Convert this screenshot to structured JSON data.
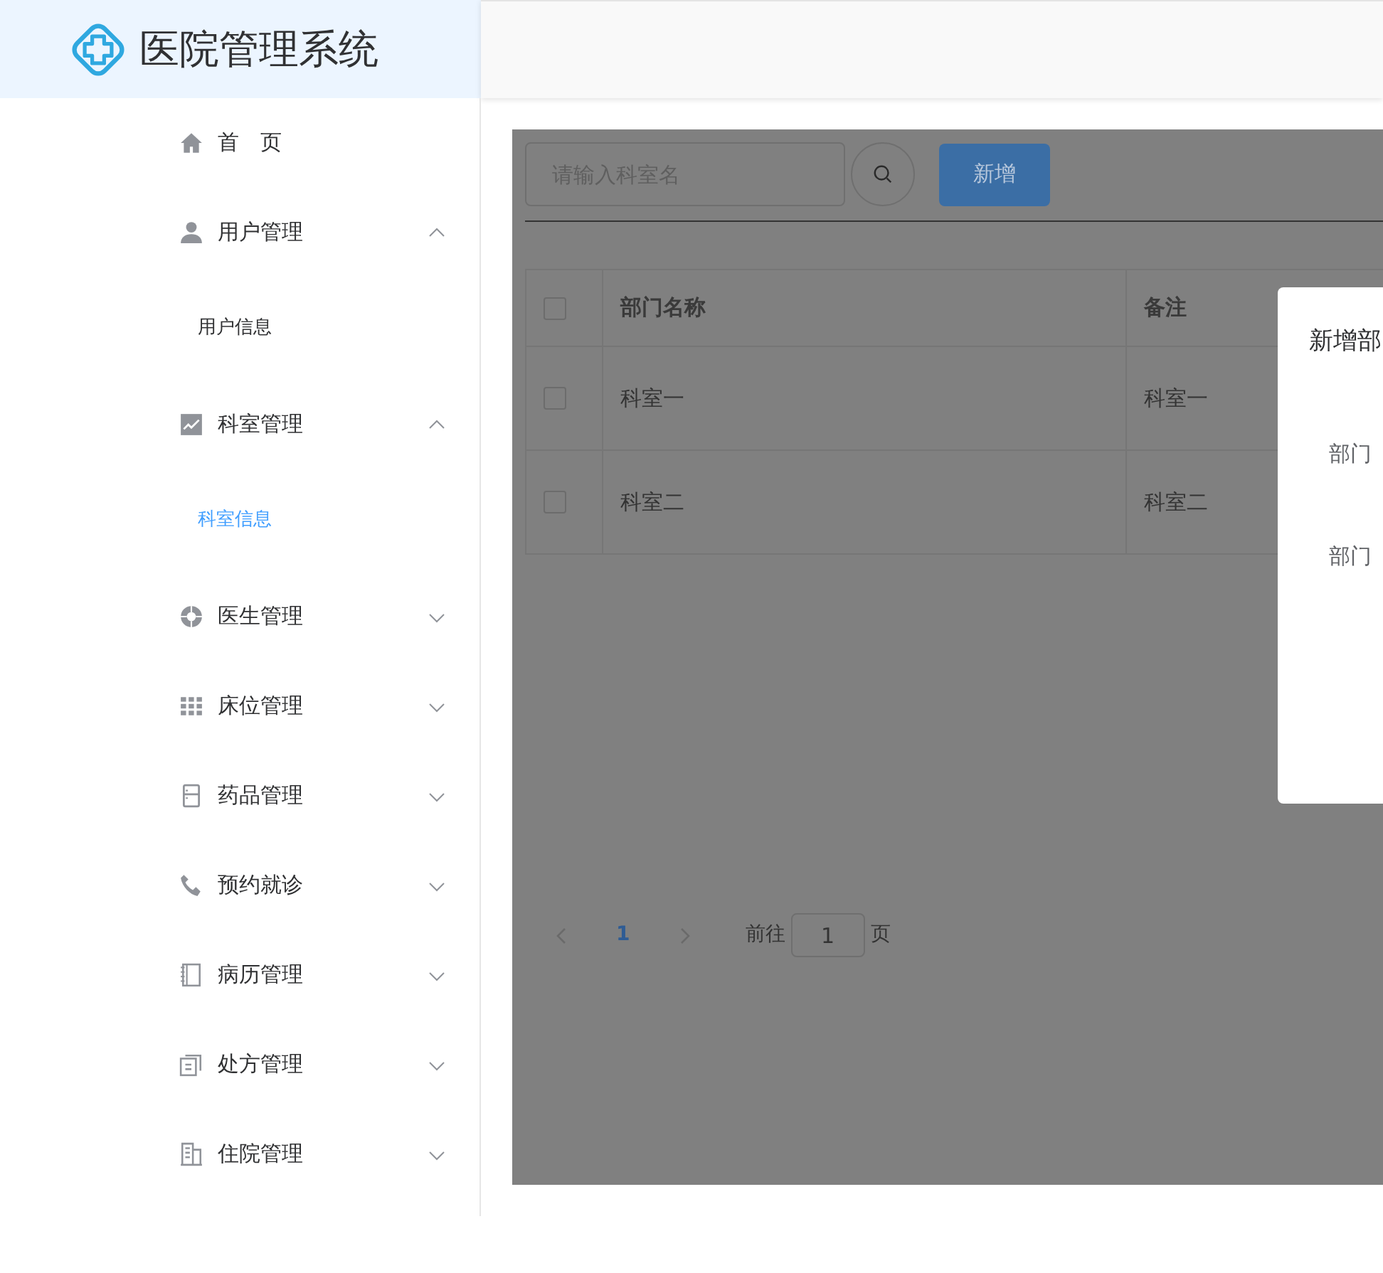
{
  "app": {
    "title": "医院管理系统"
  },
  "sidebar": {
    "items": [
      {
        "label": "首　页",
        "kind": "link"
      },
      {
        "label": "用户管理",
        "kind": "submenu",
        "expanded": true,
        "children": [
          {
            "label": "用户信息",
            "selected": false
          }
        ]
      },
      {
        "label": "科室管理",
        "kind": "submenu",
        "expanded": true,
        "children": [
          {
            "label": "科室信息",
            "selected": true
          }
        ]
      },
      {
        "label": "医生管理",
        "kind": "submenu",
        "expanded": false
      },
      {
        "label": "床位管理",
        "kind": "submenu",
        "expanded": false
      },
      {
        "label": "药品管理",
        "kind": "submenu",
        "expanded": false
      },
      {
        "label": "预约就诊",
        "kind": "submenu",
        "expanded": false
      },
      {
        "label": "病历管理",
        "kind": "submenu",
        "expanded": false
      },
      {
        "label": "处方管理",
        "kind": "submenu",
        "expanded": false
      },
      {
        "label": "住院管理",
        "kind": "submenu",
        "expanded": false
      }
    ]
  },
  "toolbar": {
    "search": {
      "placeholder": "请输入科室名"
    },
    "add_button": "新增"
  },
  "table": {
    "header_checked": false,
    "columns": [
      "部门名称",
      "备注"
    ],
    "rows": [
      {
        "checked": false,
        "cells": [
          "科室一",
          "科室一"
        ]
      },
      {
        "checked": false,
        "cells": [
          "科室二",
          "科室二"
        ]
      }
    ]
  },
  "pagination": {
    "pages": [
      {
        "label": "1",
        "selected": true
      }
    ],
    "goto_label": "前往",
    "goto_value": "1",
    "goto_suffix": "页"
  },
  "dialog": {
    "title": "新增部",
    "fields": [
      {
        "label": "部门"
      },
      {
        "label": "部门"
      }
    ]
  }
}
